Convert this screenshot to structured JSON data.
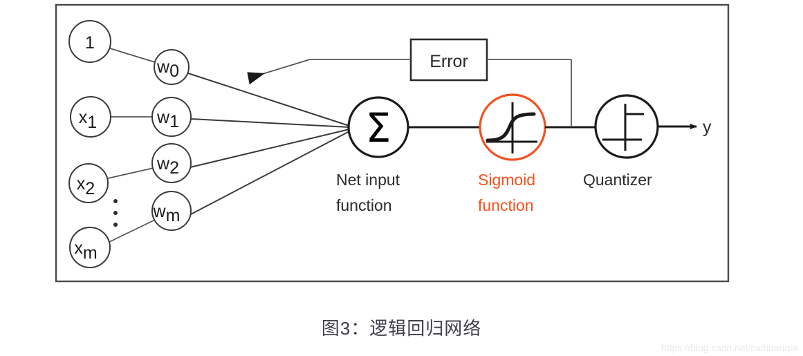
{
  "figure": {
    "caption": "图3：逻辑回归网络",
    "watermark": "https://blog.csdn.net/caihuanqia",
    "colors": {
      "accent_red": "#f4511e",
      "line": "#3a3a3a",
      "text": "#2b2b2b",
      "background": "#ffffff"
    }
  },
  "inputs": [
    {
      "label": "1",
      "sub": ""
    },
    {
      "label": "x",
      "sub": "1"
    },
    {
      "label": "x",
      "sub": "2"
    },
    {
      "label": "x",
      "sub": "m"
    }
  ],
  "weights": [
    {
      "label": "w",
      "sub": "0"
    },
    {
      "label": "w",
      "sub": "1"
    },
    {
      "label": "w",
      "sub": "2"
    },
    {
      "label": "w",
      "sub": "m"
    }
  ],
  "ellipsis": "⋮",
  "stages": {
    "net_input": {
      "symbol": "Σ",
      "label_line1": "Net input",
      "label_line2": "function"
    },
    "sigmoid": {
      "symbol": "sigmoid-curve-icon",
      "label_line1": "Sigmoid",
      "label_line2": "function"
    },
    "quantizer": {
      "symbol": "step-function-icon",
      "label_line1": "Quantizer",
      "label_line2": ""
    }
  },
  "error": {
    "label": "Error"
  },
  "output": {
    "label": "y"
  }
}
